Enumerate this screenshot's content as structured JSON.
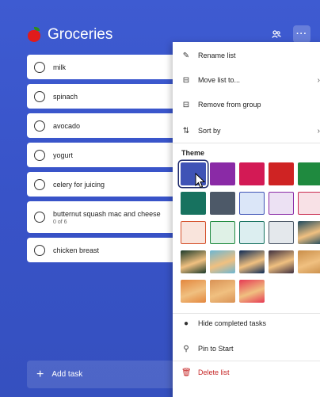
{
  "list": {
    "title": "Groceries",
    "share_icon": "share-icon",
    "more_label": "···"
  },
  "tasks": [
    {
      "label": "milk"
    },
    {
      "label": "spinach"
    },
    {
      "label": "avocado"
    },
    {
      "label": "yogurt"
    },
    {
      "label": "celery for juicing"
    },
    {
      "label": "butternut squash mac and cheese",
      "sub": "0 of 6"
    },
    {
      "label": "chicken breast"
    }
  ],
  "add_task": {
    "plus": "+",
    "label": "Add task"
  },
  "menu": {
    "rename": "Rename list",
    "move": "Move list to...",
    "remove": "Remove from group",
    "sort": "Sort by",
    "theme_heading": "Theme",
    "hide_completed": "Hide completed tasks",
    "pin": "Pin to Start",
    "delete": "Delete list"
  },
  "theme_swatches": [
    {
      "name": "blue",
      "color": "#3f53b6",
      "selected": true
    },
    {
      "name": "purple",
      "color": "#8a2aa6"
    },
    {
      "name": "magenta",
      "color": "#d31a55"
    },
    {
      "name": "red",
      "color": "#cf2323"
    },
    {
      "name": "green",
      "color": "#1f8a3f"
    },
    {
      "name": "teal",
      "color": "#17725f"
    },
    {
      "name": "slate",
      "color": "#4d5968"
    },
    {
      "name": "light-blue",
      "color": "#dbe6f8",
      "border": "#3f53b6"
    },
    {
      "name": "light-purple",
      "color": "#ece1f3",
      "border": "#8a2aa6"
    },
    {
      "name": "light-pink",
      "color": "#f8e1e6",
      "border": "#c92a50"
    },
    {
      "name": "light-salmon",
      "color": "#f9e4dc",
      "border": "#d5532e"
    },
    {
      "name": "light-green",
      "color": "#dff1e6",
      "border": "#1f8a3f"
    },
    {
      "name": "light-teal",
      "color": "#dceef0",
      "border": "#17725f"
    },
    {
      "name": "light-gray",
      "color": "#e4e8ec",
      "border": "#4d5968"
    },
    {
      "name": "photo-sunset-dock",
      "color": "#1e4a5e"
    },
    {
      "name": "photo-green-lights",
      "color": "#1b3a2a"
    },
    {
      "name": "photo-beach",
      "color": "#6cb6d3"
    },
    {
      "name": "photo-night-sky",
      "color": "#0d2a55"
    },
    {
      "name": "photo-sunset-field",
      "color": "#3e2f3e"
    },
    {
      "name": "photo-coast",
      "color": "#c98e4a"
    },
    {
      "name": "photo-lighthouse",
      "color": "#e3873e"
    },
    {
      "name": "photo-desert",
      "color": "#d99255"
    },
    {
      "name": "photo-pink-gradient",
      "color": "#e63a54"
    }
  ],
  "colors": {
    "accent": "#3e5bd1",
    "danger": "#c62828"
  }
}
